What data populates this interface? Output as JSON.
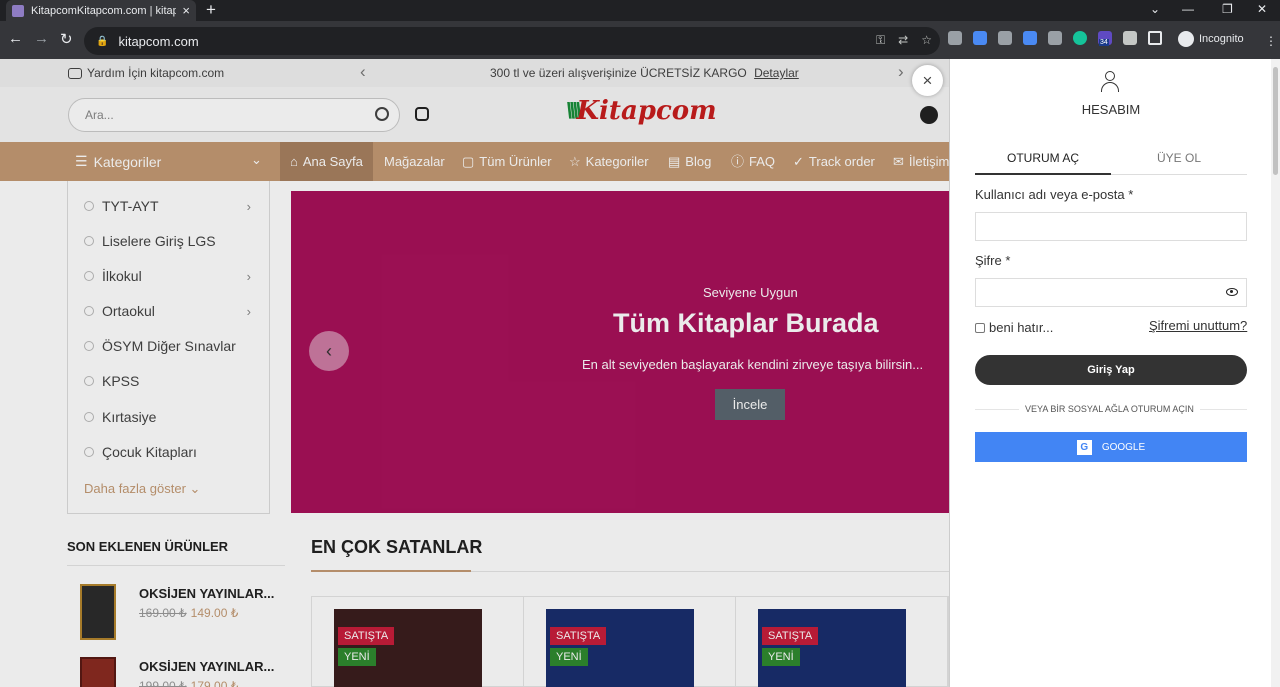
{
  "browser": {
    "tab_title": "KitapcomKitapcom.com | kitapc",
    "tab_close": "×",
    "new_tab": "+",
    "url": "kitapcom.com",
    "incognito_label": "Incognito",
    "ext_badge": "34",
    "back": "←",
    "forward": "→",
    "reload": "↻",
    "minimize": "—",
    "maximize": "❐",
    "close": "✕",
    "tab_search": "⌄"
  },
  "topbar": {
    "help_text": "Yardım İçin kitapcom.com",
    "promo_text": "300 tl ve üzeri alışverişinize ÜCRETSİZ KARGO",
    "promo_link": "Detaylar",
    "prev_arrow": "‹",
    "next_arrow": "›"
  },
  "header": {
    "search_placeholder": "Ara...",
    "logo_mark": "\\\\\\\\",
    "logo_text": "Kitapcom"
  },
  "menu": {
    "categories_label": "Kategoriler",
    "categories_chevron": "⌄",
    "items": [
      {
        "icon": "⌂",
        "label": "Ana Sayfa"
      },
      {
        "label": "Mağazalar"
      },
      {
        "icon": "▢",
        "label": "Tüm Ürünler"
      },
      {
        "icon": "☆",
        "label": "Kategoriler"
      },
      {
        "icon": "▤",
        "label": "Blog"
      },
      {
        "icon": "ⓘ",
        "label": "FAQ"
      },
      {
        "icon": "✓",
        "label": "Track order"
      },
      {
        "icon": "✉",
        "label": "İletişim"
      }
    ]
  },
  "sidebar": {
    "items": [
      {
        "label": "TYT-AYT",
        "arrow": "›"
      },
      {
        "label": "Liselere Giriş LGS",
        "arrow": ""
      },
      {
        "label": "İlkokul",
        "arrow": "›"
      },
      {
        "label": "Ortaokul",
        "arrow": "›"
      },
      {
        "label": "ÖSYM Diğer Sınavlar",
        "arrow": ""
      },
      {
        "label": "KPSS",
        "arrow": ""
      },
      {
        "label": "Kırtasiye",
        "arrow": ""
      },
      {
        "label": "Çocuk Kitapları",
        "arrow": ""
      }
    ],
    "more_label": "Daha fazla göster ⌄"
  },
  "banner": {
    "subtitle": "Seviyene Uygun",
    "title": "Tüm Kitaplar Burada",
    "description": "En alt seviyeden başlayarak kendini zirveye taşıya bilirsin...",
    "button_label": "İncele",
    "prev_arrow": "‹",
    "bg_color": "#a8115a"
  },
  "recent": {
    "title": "SON EKLENEN ÜRÜNLER",
    "items": [
      {
        "name": "OKSİJEN YAYINLAR...",
        "old_price": "169.00 ₺",
        "new_price": "149.00 ₺"
      },
      {
        "name": "OKSİJEN YAYINLAR...",
        "old_price": "199.00 ₺",
        "new_price": "179.00 ₺"
      }
    ]
  },
  "bestsellers": {
    "title": "EN ÇOK SATANLAR",
    "cards": [
      {
        "sale_tag": "SATIŞTA",
        "new_tag": "YENİ"
      },
      {
        "sale_tag": "SATIŞTA",
        "new_tag": "YENİ"
      },
      {
        "sale_tag": "SATIŞTA",
        "new_tag": "YENİ"
      }
    ]
  },
  "login_panel": {
    "close": "×",
    "title": "HESABIM",
    "tab_login": "OTURUM AÇ",
    "tab_register": "ÜYE OL",
    "username_label": "Kullanıcı adı veya e-posta  *",
    "password_label": "Şifre *",
    "username_value": "",
    "password_value": "",
    "remember_label": "beni hatır...",
    "forgot_label": "Şifremi unuttum?",
    "login_button": "Giriş Yap",
    "social_divider": "VEYA BİR SOSYAL AĞLA OTURUM AÇIN",
    "google_button": "GOOGLE",
    "google_letter": "G"
  },
  "colors": {
    "accent": "#c49a73",
    "banner": "#a8115a",
    "google": "#4285f4"
  }
}
